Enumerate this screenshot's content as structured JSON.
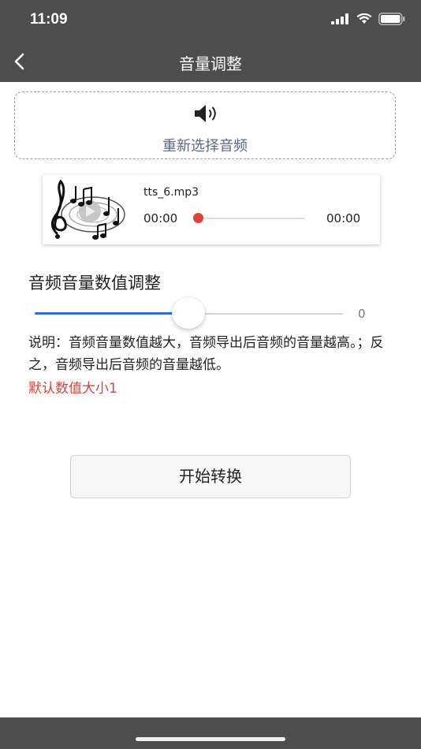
{
  "status_bar": {
    "time": "11:09"
  },
  "nav": {
    "title": "音量调整"
  },
  "reselect": {
    "label": "重新选择音频"
  },
  "player": {
    "file_name": "tts_6.mp3",
    "current_time": "00:00",
    "total_time": "00:00",
    "progress": 0
  },
  "volume": {
    "section_title": "音频音量数值调整",
    "value_label": "0",
    "slider_fraction": 0.5
  },
  "description": {
    "text": "说明：音频音量数值越大，音频导出后音频的音量越高。；反之，音频导出后音频的音量越低。",
    "default_note": "默认数值大小1"
  },
  "actions": {
    "start_label": "开始转换"
  },
  "colors": {
    "bar": "#4d4d4d",
    "accent_blue": "#2f6fd6",
    "accent_red": "#e0413a",
    "link_gray_blue": "#5a6a86"
  },
  "icons": {
    "back": "chevron-left-icon",
    "speaker": "speaker-icon",
    "cover": "music-note-cover-icon"
  }
}
